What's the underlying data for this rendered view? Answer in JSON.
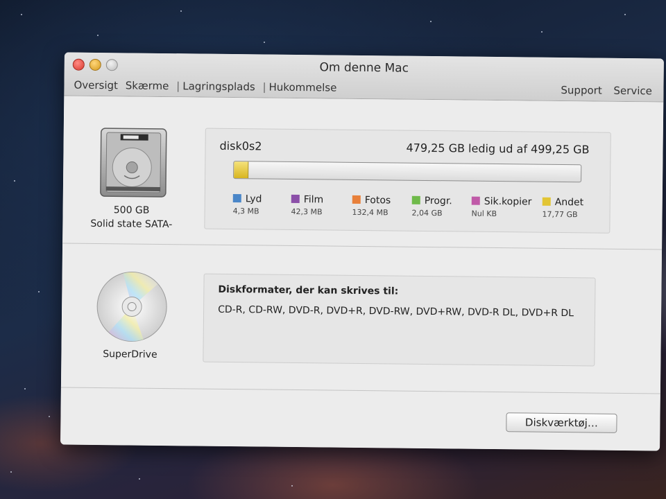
{
  "window": {
    "title": "Om denne Mac",
    "tabs": [
      "Oversigt",
      "Skærme",
      "Lagringsplads",
      "Hukommelse"
    ],
    "right_tabs": [
      "Support",
      "Service"
    ]
  },
  "drives": [
    {
      "icon": "hard-drive-icon",
      "capacity": "500 GB",
      "type": "Solid state SATA-"
    },
    {
      "icon": "optical-disc-icon",
      "name": "SuperDrive"
    }
  ],
  "storage": {
    "volume": "disk0s2",
    "free_text": "479,25 GB ledig ud af 499,25 GB",
    "used_fraction": 0.04,
    "categories": [
      {
        "name": "Lyd",
        "value": "4,3 MB",
        "color": "#4a86c8"
      },
      {
        "name": "Film",
        "value": "42,3 MB",
        "color": "#8b4fa8"
      },
      {
        "name": "Fotos",
        "value": "132,4 MB",
        "color": "#e8803a"
      },
      {
        "name": "Progr.",
        "value": "2,04 GB",
        "color": "#6fba4a"
      },
      {
        "name": "Sik.kopier",
        "value": "Nul KB",
        "color": "#c05aa8"
      },
      {
        "name": "Andet",
        "value": "17,77 GB",
        "color": "#e2c534"
      }
    ]
  },
  "superdrive": {
    "formats_title": "Diskformater, der kan skrives til:",
    "formats_text": "CD-R, CD-RW, DVD-R, DVD+R, DVD-RW, DVD+RW, DVD-R DL, DVD+R DL"
  },
  "button": {
    "label": "Diskværktøj…"
  }
}
